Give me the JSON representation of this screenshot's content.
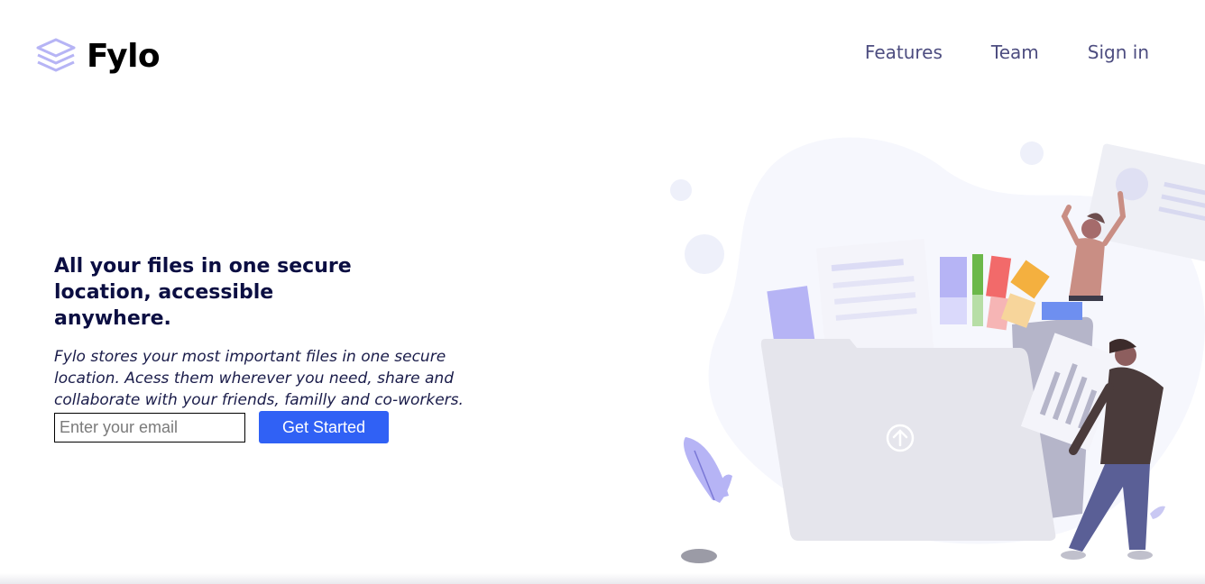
{
  "brand": {
    "name": "Fylo",
    "logo_icon": "stacked-layers-icon",
    "accent": "#3061f5",
    "logo_color": "#b6b4f5"
  },
  "nav": {
    "items": [
      {
        "label": "Features"
      },
      {
        "label": "Team"
      },
      {
        "label": "Sign in"
      }
    ]
  },
  "hero": {
    "headline": "All your files in one secure location, accessible anywhere.",
    "subtext": "Fylo stores your most important files in one secure location. Acess them wherever you need, share and collaborate with your friends, familly and co-workers.",
    "email_placeholder": "Enter your email",
    "cta_label": "Get Started"
  }
}
